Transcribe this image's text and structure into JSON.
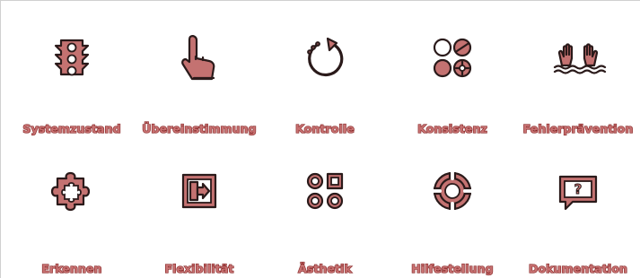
{
  "tiles": [
    {
      "label": "Systemzustand",
      "icon": "traffic-light-icon"
    },
    {
      "label": "Übereinstimmung",
      "icon": "pointing-hand-icon"
    },
    {
      "label": "Kontrolle",
      "icon": "undo-arrow-icon"
    },
    {
      "label": "Konsistenz",
      "icon": "circles-grid-icon"
    },
    {
      "label": "Fehlerprävention",
      "icon": "drowning-hands-icon"
    },
    {
      "label": "Erkennen",
      "icon": "puzzle-piece-icon"
    },
    {
      "label": "Flexibilität",
      "icon": "exit-door-icon"
    },
    {
      "label": "Ästhetik",
      "icon": "shapes-icon"
    },
    {
      "label": "Hilfestellung",
      "icon": "lifebuoy-icon"
    },
    {
      "label": "Dokumentation",
      "icon": "question-bubble-icon"
    }
  ],
  "colors": {
    "label_fill": "#c87272",
    "label_outline": "#8a2b2b",
    "icon_fill": "#c47271",
    "icon_outline": "#2a1a1a"
  }
}
